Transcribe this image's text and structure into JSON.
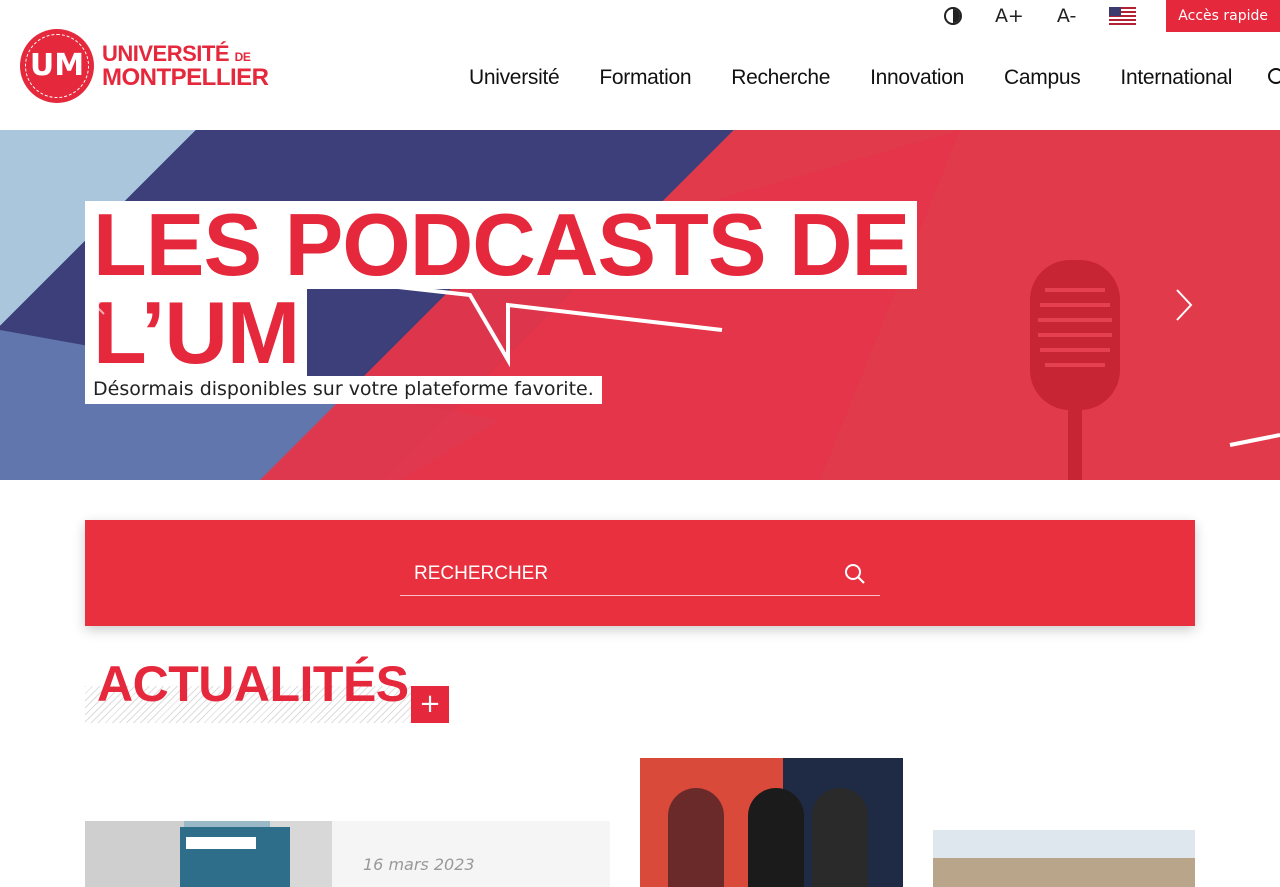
{
  "header": {
    "logo": {
      "line1": "UNIVERSITÉ",
      "line1_small": "DE",
      "line2": "MONTPELLIER",
      "seal": "UM"
    },
    "utility": {
      "contrast_icon": "contrast-icon",
      "font_increase": "A+",
      "font_decrease": "A-",
      "language_flag": "us-flag-icon",
      "quick_access": "Accès rapide"
    },
    "nav": [
      "Université",
      "Formation",
      "Recherche",
      "Innovation",
      "Campus",
      "International"
    ],
    "search_icon": "search-icon"
  },
  "banner": {
    "title_line1": "LES PODCASTS DE",
    "title_line2": "L’UM",
    "subtitle": "Désormais disponibles sur votre plateforme favorite."
  },
  "search": {
    "placeholder": "RECHERCHER"
  },
  "news": {
    "title": "ACTUALITÉS",
    "more": "+",
    "cards": [
      {
        "date": "16 mars 2023"
      }
    ]
  },
  "colors": {
    "accent": "#e5283c"
  }
}
